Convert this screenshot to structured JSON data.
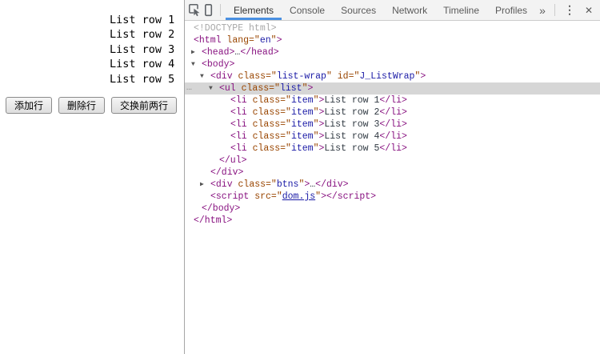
{
  "colors": {
    "accent_tab_underline": "#4a90e2",
    "selection_background": "#d6d6d6",
    "syntax_tag": "#881280",
    "syntax_attribute": "#994500",
    "syntax_value": "#1a1aa6",
    "syntax_doctype": "#a8a8a8",
    "toolbar_background": "#f3f3f3"
  },
  "page": {
    "list_rows": [
      "List row 1",
      "List row 2",
      "List row 3",
      "List row 4",
      "List row 5"
    ],
    "buttons": [
      "添加行",
      "删除行",
      "交换前两行"
    ]
  },
  "devtools": {
    "icons": {
      "inspect": "inspect-element-cursor",
      "device": "device-toolbar-phone",
      "arrow_down": "▼",
      "arrow_right": "▶",
      "gutter_ellipsis": "…",
      "more_tabs_glyph": "»",
      "menu_glyph": "⋮",
      "close_glyph": "✕"
    },
    "toolbar": {
      "tabs": [
        {
          "label": "Elements",
          "active": true
        },
        {
          "label": "Console",
          "active": false
        },
        {
          "label": "Sources",
          "active": false
        },
        {
          "label": "Network",
          "active": false
        },
        {
          "label": "Timeline",
          "active": false
        },
        {
          "label": "Profiles",
          "active": false
        }
      ]
    },
    "code": {
      "lines": [
        {
          "indent": 0,
          "seg": [
            {
              "c": "doctype",
              "s": "<!DOCTYPE html>"
            }
          ]
        },
        {
          "indent": 0,
          "seg": [
            {
              "c": "tag",
              "s": "<html"
            },
            {
              "c": "attr",
              "s": " lang"
            },
            {
              "c": "punc",
              "s": "=\""
            },
            {
              "c": "val",
              "s": "en"
            },
            {
              "c": "punc",
              "s": "\""
            },
            {
              "c": "tag",
              "s": ">"
            }
          ]
        },
        {
          "indent": 1,
          "arrow": "right",
          "seg": [
            {
              "c": "tag",
              "s": "<head>"
            },
            {
              "c": "text",
              "s": "…"
            },
            {
              "c": "tag",
              "s": "</head>"
            }
          ]
        },
        {
          "indent": 1,
          "arrow": "down",
          "seg": [
            {
              "c": "tag",
              "s": "<body>"
            }
          ]
        },
        {
          "indent": 2,
          "arrow": "down",
          "seg": [
            {
              "c": "tag",
              "s": "<div"
            },
            {
              "c": "attr",
              "s": " class"
            },
            {
              "c": "punc",
              "s": "=\""
            },
            {
              "c": "val",
              "s": "list-wrap"
            },
            {
              "c": "punc",
              "s": "\""
            },
            {
              "c": "attr",
              "s": " id"
            },
            {
              "c": "punc",
              "s": "=\""
            },
            {
              "c": "val",
              "s": "J_ListWrap"
            },
            {
              "c": "punc",
              "s": "\""
            },
            {
              "c": "tag",
              "s": ">"
            }
          ]
        },
        {
          "indent": 3,
          "arrow": "down",
          "selected": true,
          "seg": [
            {
              "c": "tag",
              "s": "<ul"
            },
            {
              "c": "attr",
              "s": " class"
            },
            {
              "c": "punc",
              "s": "=\""
            },
            {
              "c": "val",
              "s": "list"
            },
            {
              "c": "punc",
              "s": "\""
            },
            {
              "c": "tag",
              "s": ">"
            }
          ]
        },
        {
          "indent": 4,
          "seg": [
            {
              "c": "tag",
              "s": "<li"
            },
            {
              "c": "attr",
              "s": " class"
            },
            {
              "c": "punc",
              "s": "=\""
            },
            {
              "c": "val",
              "s": "item"
            },
            {
              "c": "punc",
              "s": "\""
            },
            {
              "c": "tag",
              "s": ">"
            },
            {
              "c": "text",
              "s": "List row 1"
            },
            {
              "c": "tag",
              "s": "</li>"
            }
          ]
        },
        {
          "indent": 4,
          "seg": [
            {
              "c": "tag",
              "s": "<li"
            },
            {
              "c": "attr",
              "s": " class"
            },
            {
              "c": "punc",
              "s": "=\""
            },
            {
              "c": "val",
              "s": "item"
            },
            {
              "c": "punc",
              "s": "\""
            },
            {
              "c": "tag",
              "s": ">"
            },
            {
              "c": "text",
              "s": "List row 2"
            },
            {
              "c": "tag",
              "s": "</li>"
            }
          ]
        },
        {
          "indent": 4,
          "seg": [
            {
              "c": "tag",
              "s": "<li"
            },
            {
              "c": "attr",
              "s": " class"
            },
            {
              "c": "punc",
              "s": "=\""
            },
            {
              "c": "val",
              "s": "item"
            },
            {
              "c": "punc",
              "s": "\""
            },
            {
              "c": "tag",
              "s": ">"
            },
            {
              "c": "text",
              "s": "List row 3"
            },
            {
              "c": "tag",
              "s": "</li>"
            }
          ]
        },
        {
          "indent": 4,
          "seg": [
            {
              "c": "tag",
              "s": "<li"
            },
            {
              "c": "attr",
              "s": " class"
            },
            {
              "c": "punc",
              "s": "=\""
            },
            {
              "c": "val",
              "s": "item"
            },
            {
              "c": "punc",
              "s": "\""
            },
            {
              "c": "tag",
              "s": ">"
            },
            {
              "c": "text",
              "s": "List row 4"
            },
            {
              "c": "tag",
              "s": "</li>"
            }
          ]
        },
        {
          "indent": 4,
          "seg": [
            {
              "c": "tag",
              "s": "<li"
            },
            {
              "c": "attr",
              "s": " class"
            },
            {
              "c": "punc",
              "s": "=\""
            },
            {
              "c": "val",
              "s": "item"
            },
            {
              "c": "punc",
              "s": "\""
            },
            {
              "c": "tag",
              "s": ">"
            },
            {
              "c": "text",
              "s": "List row 5"
            },
            {
              "c": "tag",
              "s": "</li>"
            }
          ]
        },
        {
          "indent": 3,
          "seg": [
            {
              "c": "tag",
              "s": "</ul>"
            }
          ]
        },
        {
          "indent": 2,
          "seg": [
            {
              "c": "tag",
              "s": "</div>"
            }
          ]
        },
        {
          "indent": 2,
          "arrow": "right",
          "seg": [
            {
              "c": "tag",
              "s": "<div"
            },
            {
              "c": "attr",
              "s": " class"
            },
            {
              "c": "punc",
              "s": "=\""
            },
            {
              "c": "val",
              "s": "btns"
            },
            {
              "c": "punc",
              "s": "\""
            },
            {
              "c": "tag",
              "s": ">"
            },
            {
              "c": "text",
              "s": "…"
            },
            {
              "c": "tag",
              "s": "</div>"
            }
          ]
        },
        {
          "indent": 2,
          "seg": [
            {
              "c": "tag",
              "s": "<script"
            },
            {
              "c": "attr",
              "s": " src"
            },
            {
              "c": "punc",
              "s": "=\""
            },
            {
              "c": "link",
              "s": "dom.js"
            },
            {
              "c": "punc",
              "s": "\""
            },
            {
              "c": "tag",
              "s": "></script>"
            }
          ]
        },
        {
          "indent": 1,
          "seg": [
            {
              "c": "tag",
              "s": "</body>"
            }
          ]
        },
        {
          "indent": 0,
          "seg": [
            {
              "c": "tag",
              "s": "</html>"
            }
          ]
        }
      ]
    }
  }
}
